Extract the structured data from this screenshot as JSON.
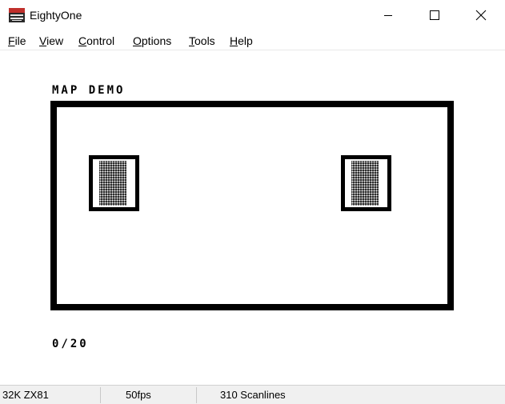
{
  "window": {
    "title": "EightyOne",
    "icon": "zx81-app-icon",
    "controls": [
      "minimize-icon",
      "maximize-icon",
      "close-icon"
    ]
  },
  "menu": {
    "items": [
      {
        "key": "F",
        "rest": "ile"
      },
      {
        "key": "V",
        "rest": "iew"
      },
      {
        "key": "C",
        "rest": "ontrol"
      },
      {
        "key": "O",
        "rest": "ptions"
      },
      {
        "key": "T",
        "rest": "ools"
      },
      {
        "key": "H",
        "rest": "elp"
      }
    ]
  },
  "screen": {
    "heading": "MAP DEMO",
    "counter": "0/20",
    "doors": [
      "left-door",
      "right-door"
    ]
  },
  "status": {
    "machine": "32K ZX81",
    "fps": "50fps",
    "scanlines": "310 Scanlines"
  },
  "colors": {
    "foreground": "#000000",
    "background": "#ffffff",
    "statusbar": "#f0f0f0"
  }
}
